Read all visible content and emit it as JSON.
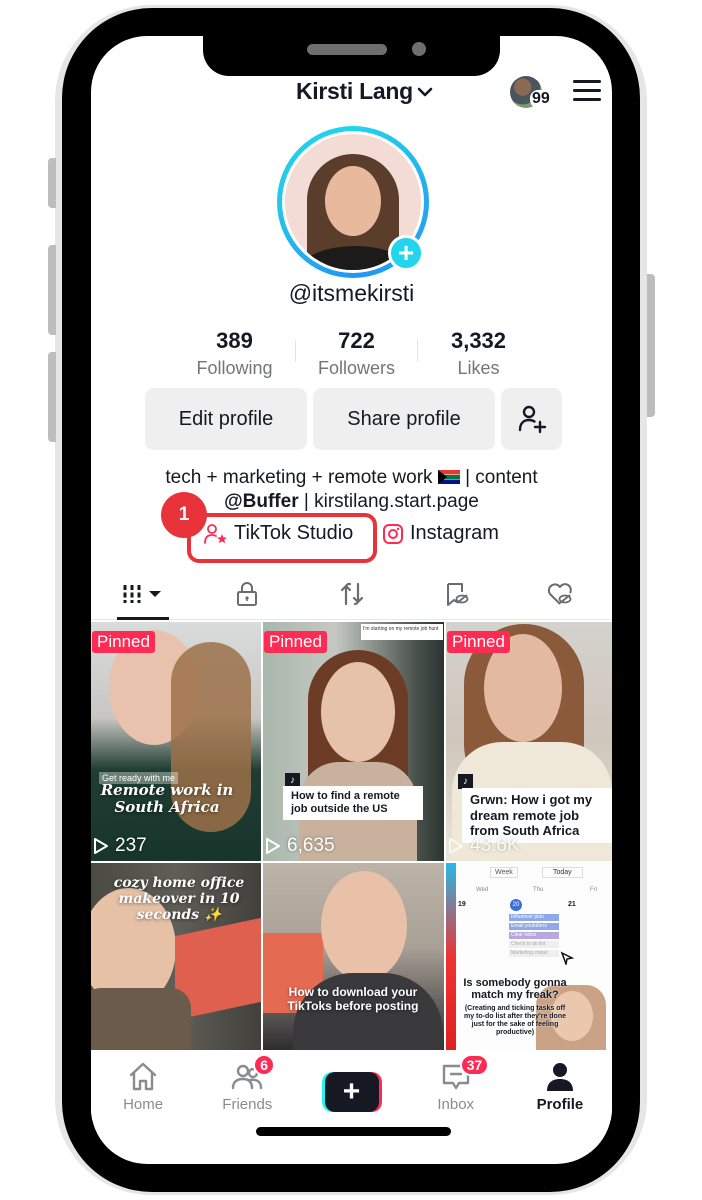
{
  "header": {
    "title": "Kirsti Lang",
    "account_notification_count": "99"
  },
  "profile": {
    "username": "@itsmekirsti",
    "stats": [
      {
        "value": "389",
        "label": "Following"
      },
      {
        "value": "722",
        "label": "Followers"
      },
      {
        "value": "3,332",
        "label": "Likes"
      }
    ],
    "buttons": {
      "edit": "Edit profile",
      "share": "Share profile"
    },
    "bio": {
      "line1_text": "tech + marketing + remote work",
      "line1_suffix": " | content",
      "line2_handle": "@Buffer",
      "line2_rest": " | kirstilang.start.page"
    },
    "links": {
      "studio": "TikTok Studio",
      "instagram": "Instagram"
    }
  },
  "annotation": {
    "step_number": "1"
  },
  "tabs": [
    {
      "icon": "grid-icon",
      "active": true
    },
    {
      "icon": "lock-icon",
      "active": false
    },
    {
      "icon": "repost-icon",
      "active": false
    },
    {
      "icon": "bookmark-hidden-icon",
      "active": false
    },
    {
      "icon": "liked-hidden-icon",
      "active": false
    }
  ],
  "videos": [
    {
      "pinned_label": "Pinned",
      "views": "237",
      "overlay_small": "Get ready with me",
      "caption": "Remote work in South Africa"
    },
    {
      "pinned_label": "Pinned",
      "views": "6,635",
      "reply_bubble": "I'm starting on my remote job hunt",
      "caption": "How to find a remote job outside the US"
    },
    {
      "pinned_label": "Pinned",
      "views": "43.6K",
      "caption": "Grwn: How i got my dream remote job from South Africa"
    },
    {
      "caption": "cozy home office makeover in 10 seconds ✨"
    },
    {
      "caption": "How to download your TikToks before posting"
    },
    {
      "calendar": {
        "view": "Week",
        "today": "Today",
        "days": [
          "Wed",
          "Thu",
          "Fri"
        ],
        "dates": [
          "19",
          "20",
          "21"
        ],
        "tasks": [
          "Influencer plan",
          "Email youtubers",
          "Clear inbox",
          "Check to do list",
          "Marketing colour"
        ]
      },
      "caption": "Is somebody gonna match my freak?",
      "sub_caption": "(Creating and ticking tasks off my to-do list after they're done just for the sake of feeling productive)"
    }
  ],
  "bottom_nav": [
    {
      "label": "Home",
      "badge": null,
      "active": false
    },
    {
      "label": "Friends",
      "badge": "6",
      "active": false
    },
    {
      "label": "",
      "badge": null,
      "active": false
    },
    {
      "label": "Inbox",
      "badge": "37",
      "active": false
    },
    {
      "label": "Profile",
      "badge": null,
      "active": true
    }
  ],
  "colors": {
    "brand_red": "#fe2c55",
    "brand_cyan": "#25f4ee",
    "annotation_red": "#e8333b",
    "avatar_ring": "#20d5ec"
  }
}
